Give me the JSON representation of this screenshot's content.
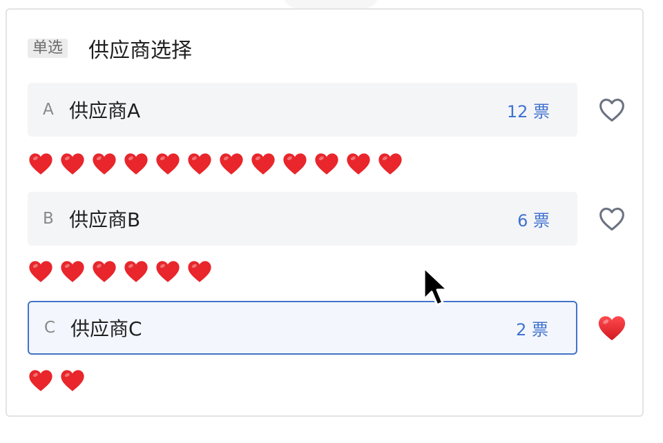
{
  "poll": {
    "type_badge": "单选",
    "title": "供应商选择",
    "options": [
      {
        "letter": "A",
        "name": "供应商A",
        "votes_label": "12 票",
        "votes": 12,
        "voted": false
      },
      {
        "letter": "B",
        "name": "供应商B",
        "votes_label": "6 票",
        "votes": 6,
        "voted": false
      },
      {
        "letter": "C",
        "name": "供应商C",
        "votes_label": "2 票",
        "votes": 2,
        "voted": true
      }
    ]
  },
  "icons": {
    "vote_unselected": "heart-outline-icon",
    "vote_selected": "heart-filled-icon",
    "voter": "red-heart-emoji-icon",
    "pointer": "mouse-cursor-icon"
  },
  "colors": {
    "accent": "#3f72d1",
    "selected_border": "#4173c9",
    "heart_red": "#e8262b",
    "heart_outline": "#6b7280"
  }
}
